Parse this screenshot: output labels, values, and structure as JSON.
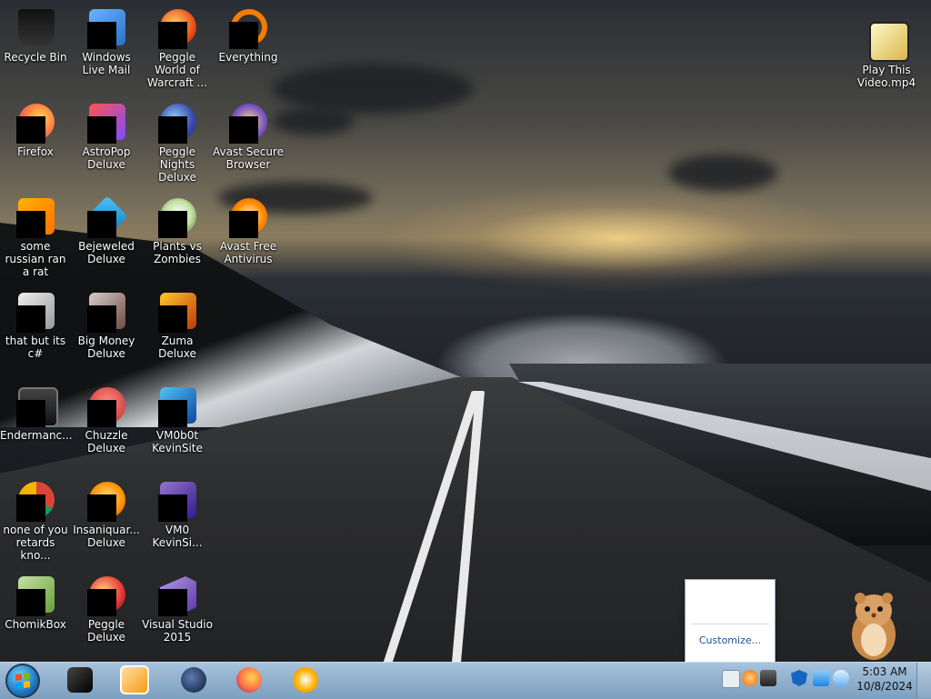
{
  "desktop": {
    "icons": [
      {
        "label": "Recycle Bin",
        "icon": "recycle-bin-icon"
      },
      {
        "label": "Windows Live Mail",
        "icon": "mail-icon"
      },
      {
        "label": "Peggle World of Warcraft ...",
        "icon": "peggle-icon"
      },
      {
        "label": "Everything",
        "icon": "search-icon"
      },
      {
        "label": "Play This Video.mp4",
        "icon": "video-file-icon"
      },
      {
        "label": "Firefox",
        "icon": "firefox-icon"
      },
      {
        "label": "AstroPop Deluxe",
        "icon": "game-icon"
      },
      {
        "label": "Peggle Nights Deluxe",
        "icon": "peggle-icon"
      },
      {
        "label": "Avast Secure Browser",
        "icon": "browser-icon"
      },
      {
        "label": "some russian ran a rat",
        "icon": "ie-icon"
      },
      {
        "label": "Bejeweled Deluxe",
        "icon": "gem-icon"
      },
      {
        "label": "Plants vs Zombies",
        "icon": "plant-icon"
      },
      {
        "label": "Avast Free Antivirus",
        "icon": "shield-icon"
      },
      {
        "label": "that but its c#",
        "icon": "folder-stack-icon"
      },
      {
        "label": "Big Money Deluxe",
        "icon": "game-icon"
      },
      {
        "label": "Zuma Deluxe",
        "icon": "game-icon"
      },
      {
        "label": "Endermanc...",
        "icon": "window-icon"
      },
      {
        "label": "Chuzzle Deluxe",
        "icon": "game-icon"
      },
      {
        "label": "VM0b0t KevinSite",
        "icon": "terminal-icon"
      },
      {
        "label": "none of you retards kno...",
        "icon": "chrome-icon"
      },
      {
        "label": "Insaniquar... Deluxe",
        "icon": "fish-icon"
      },
      {
        "label": "VM0 KevinSi...",
        "icon": "file-icon"
      },
      {
        "label": "ChomikBox",
        "icon": "hamster-icon"
      },
      {
        "label": "Peggle Deluxe",
        "icon": "peggle-icon"
      },
      {
        "label": "Visual Studio 2015",
        "icon": "visual-studio-icon"
      }
    ]
  },
  "taskbar": {
    "pinned": [
      {
        "icon": "black-window-icon",
        "color": "#111111"
      },
      {
        "icon": "media-player-icon",
        "color": "#f39c12"
      },
      {
        "icon": "globe-icon",
        "color": "#1b2a4a"
      },
      {
        "icon": "firefox-icon",
        "color": "#ff7a1a"
      },
      {
        "icon": "avast-browser-icon",
        "color": "#f39c12"
      }
    ],
    "clock": {
      "time": "5:03 AM",
      "date": "10/8/2024"
    }
  },
  "tray_popup": {
    "customize_label": "Customize..."
  },
  "colors": {
    "taskbar": "#8fb0cd",
    "accent_link": "#1e4f91"
  }
}
